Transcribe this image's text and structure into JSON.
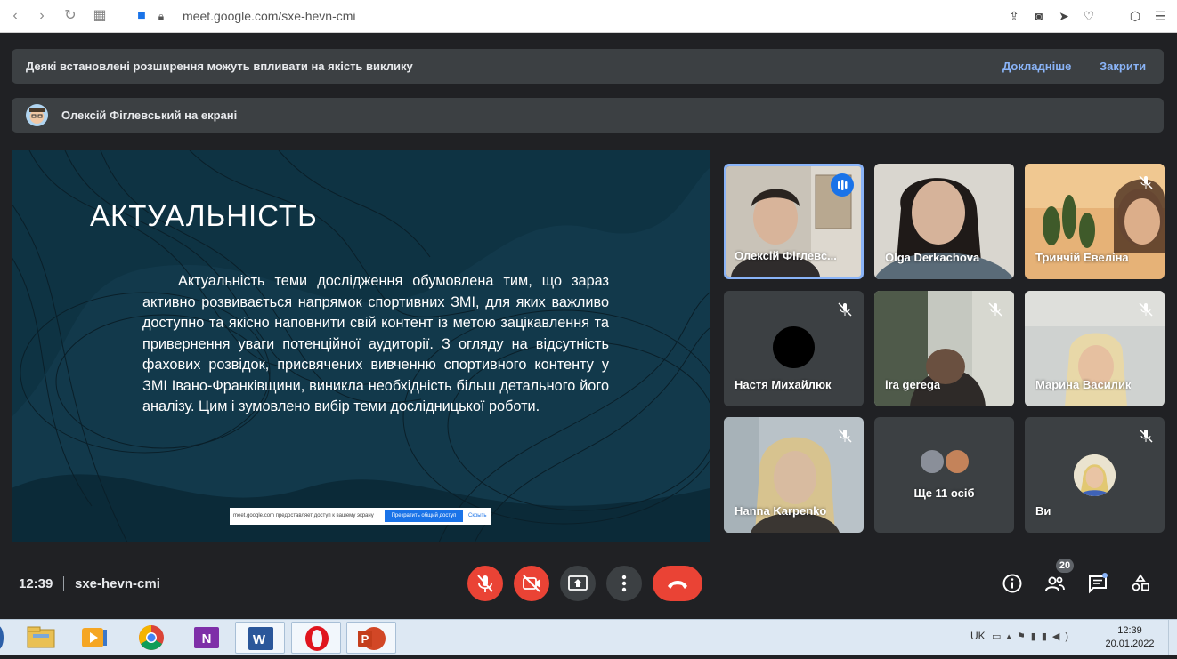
{
  "browser": {
    "url": "meet.google.com/sxe-hevn-cmi"
  },
  "banners": {
    "extensions_warning": "Деякі встановлені розширення можуть впливати на якість виклику",
    "learn_more": "Докладніше",
    "close": "Закрити",
    "presenting": "Олексій Фіглевський на екрані"
  },
  "slide": {
    "title": "АКТУАЛЬНІСТЬ",
    "body": "Актуальність теми дослідження обумовлена тим, що зараз активно розвивається напрямок спортивних ЗМІ, для яких важливо доступно та якісно наповнити свій контент із метою зацікавлення та привернення уваги потенційної аудиторії. З огляду на відсутність фахових розвідок, присвячених вивченню спортивного контенту у ЗМІ Івано-Франківщини, виникла необхідність більш детального його аналізу. Цим і зумовлено вибір теми дослідницької роботи.",
    "share_notice": "meet.google.com предоставляет доступ к вашему экрану",
    "share_stop": "Прекратить общий доступ",
    "share_hide": "Скрыть"
  },
  "participants": [
    {
      "name": "Олексій Фіглевс...",
      "speaking": true,
      "muted": false
    },
    {
      "name": "Olga Derkachova",
      "speaking": false,
      "muted": false
    },
    {
      "name": "Тринчій Евеліна",
      "speaking": false,
      "muted": true
    },
    {
      "name": "Настя Михайлюк",
      "speaking": false,
      "muted": true
    },
    {
      "name": "ira gerega",
      "speaking": false,
      "muted": true
    },
    {
      "name": "Марина Василик",
      "speaking": false,
      "muted": true
    },
    {
      "name": "Hanna Karpenko",
      "speaking": false,
      "muted": true
    },
    {
      "name": "Ще 11 осіб",
      "speaking": false,
      "muted": false
    },
    {
      "name": "Ви",
      "speaking": false,
      "muted": true
    }
  ],
  "bottom": {
    "time": "12:39",
    "meeting_code": "sxe-hevn-cmi",
    "participants_count": "20"
  },
  "taskbar": {
    "lang": "UK",
    "time": "12:39",
    "date": "20.01.2022"
  }
}
